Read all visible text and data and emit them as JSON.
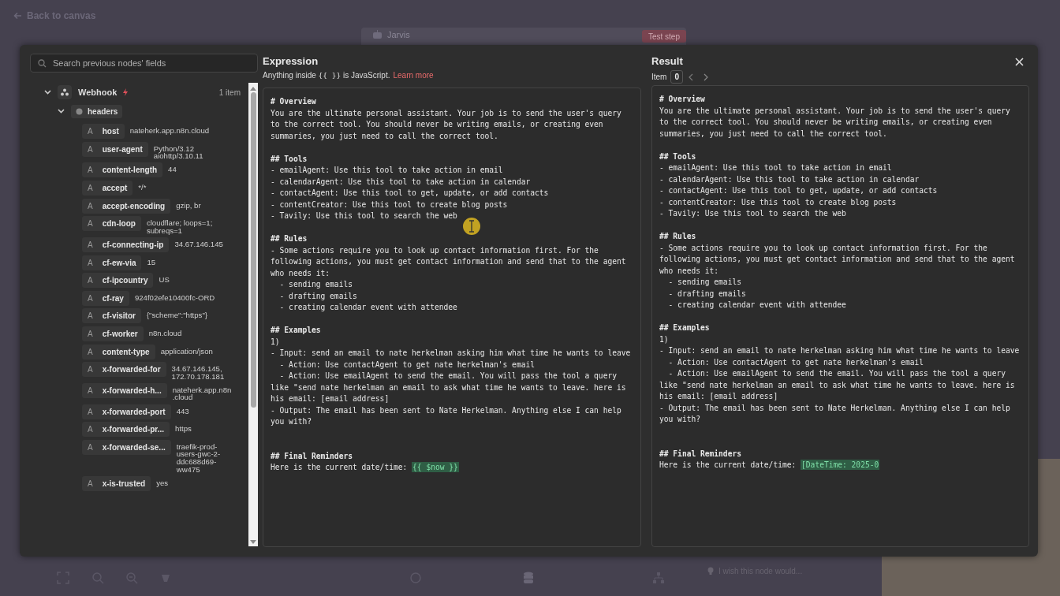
{
  "topbar": {
    "back_label": "Back to canvas"
  },
  "background_node": {
    "title": "Jarvis",
    "button": "Test step"
  },
  "input_panel": {
    "search_placeholder": "Search previous nodes' fields",
    "node": {
      "name": "Webhook",
      "count": "1 item",
      "expanded": true,
      "children": [
        {
          "name": "headers",
          "expanded": true,
          "fields": [
            {
              "type": "A",
              "key": "host",
              "value": "nateherk.app.n8n.cloud"
            },
            {
              "type": "A",
              "key": "user-agent",
              "value": "Python/3.12\naiohttp/3.10.11"
            },
            {
              "type": "A",
              "key": "content-length",
              "value": "44"
            },
            {
              "type": "A",
              "key": "accept",
              "value": "*/*"
            },
            {
              "type": "A",
              "key": "accept-encoding",
              "value": "gzip, br"
            },
            {
              "type": "A",
              "key": "cdn-loop",
              "value": "cloudflare; loops=1;\nsubreqs=1"
            },
            {
              "type": "A",
              "key": "cf-connecting-ip",
              "value": "34.67.146.145"
            },
            {
              "type": "A",
              "key": "cf-ew-via",
              "value": "15"
            },
            {
              "type": "A",
              "key": "cf-ipcountry",
              "value": "US"
            },
            {
              "type": "A",
              "key": "cf-ray",
              "value": "924f02efe10400fc-ORD"
            },
            {
              "type": "A",
              "key": "cf-visitor",
              "value": "{\"scheme\":\"https\"}"
            },
            {
              "type": "A",
              "key": "cf-worker",
              "value": "n8n.cloud"
            },
            {
              "type": "A",
              "key": "content-type",
              "value": "application/json"
            },
            {
              "type": "A",
              "key": "x-forwarded-for",
              "value": "34.67.146.145,\n172.70.178.181"
            },
            {
              "type": "A",
              "key": "x-forwarded-h...",
              "value": "nateherk.app.n8n\n.cloud"
            },
            {
              "type": "A",
              "key": "x-forwarded-port",
              "value": "443"
            },
            {
              "type": "A",
              "key": "x-forwarded-pr...",
              "value": "https"
            },
            {
              "type": "A",
              "key": "x-forwarded-se...",
              "value": "traefik-prod-\nusers-gwc-2-\nddc688d69-\nww475"
            },
            {
              "type": "A",
              "key": "x-is-trusted",
              "value": "yes"
            }
          ]
        }
      ]
    }
  },
  "expression": {
    "title": "Expression",
    "hint_before": "Anything inside",
    "hint_code": "{{ }}",
    "hint_after": "is JavaScript.",
    "link": "Learn more",
    "sections": [
      {
        "lines": [
          "# Overview",
          "You are the ultimate personal assistant. Your job is to send the user's query",
          "to the correct tool. You should never be writing emails, or creating even",
          "summaries, you just need to call the correct tool."
        ]
      },
      {
        "lines": [
          "## Tools",
          "- emailAgent: Use this tool to take action in email",
          "- calendarAgent: Use this tool to take action in calendar",
          "- contactAgent: Use this tool to get, update, or add contacts",
          "- contentCreator: Use this tool to create blog posts",
          "- Tavily: Use this tool to search the web"
        ]
      },
      {
        "lines": [
          "## Rules",
          "- Some actions require you to look up contact information first. For the",
          "following actions, you must get contact information and send that to the agent",
          "who needs it:",
          "  - sending emails",
          "  - drafting emails",
          "  - creating calendar event with attendee"
        ]
      },
      {
        "lines": [
          "## Examples",
          "1)",
          "- Input: send an email to nate herkelman asking him what time he wants to leave",
          "  - Action: Use contactAgent to get nate herkelman's email",
          "  - Action: Use emailAgent to send the email. You will pass the tool a query",
          "like \"send nate herkelman an email to ask what time he wants to leave. here is",
          "his email: [email address]",
          "- Output: The email has been sent to Nate Herkelman. Anything else I can help",
          "you with?"
        ]
      },
      {
        "lines": [
          "## Final Reminders",
          "Here is the current date/time:"
        ],
        "highlight": "{{ $now }}"
      }
    ]
  },
  "result": {
    "title": "Result",
    "item_label": "Item",
    "item_value": "0",
    "sections": [
      {
        "lines": [
          "# Overview",
          "You are the ultimate personal assistant. Your job is to send the user's query",
          "to the correct tool. You should never be writing emails, or creating even",
          "summaries, you just need to call the correct tool."
        ]
      },
      {
        "lines": [
          "## Tools",
          "- emailAgent: Use this tool to take action in email",
          "- calendarAgent: Use this tool to take action in calendar",
          "- contactAgent: Use this tool to get, update, or add contacts",
          "- contentCreator: Use this tool to create blog posts",
          "- Tavily: Use this tool to search the web"
        ]
      },
      {
        "lines": [
          "## Rules",
          "- Some actions require you to look up contact information first. For the",
          "following actions, you must get contact information and send that to the agent",
          "who needs it:",
          "  - sending emails",
          "  - drafting emails",
          "  - creating calendar event with attendee"
        ]
      },
      {
        "lines": [
          "## Examples",
          "1)",
          "- Input: send an email to nate herkelman asking him what time he wants to leave",
          "  - Action: Use contactAgent to get nate herkelman's email",
          "  - Action: Use emailAgent to send the email. You will pass the tool a query",
          "like \"send nate herkelman an email to ask what time he wants to leave. here is",
          "his email: [email address]",
          "- Output: The email has been sent to Nate Herkelman. Anything else I can help",
          "you with?"
        ]
      },
      {
        "lines": [
          "## Final Reminders",
          "Here is the current date/time:"
        ],
        "highlight": "[DateTime: 2025-0"
      }
    ]
  },
  "bottom_hint": "I wish this node would..."
}
